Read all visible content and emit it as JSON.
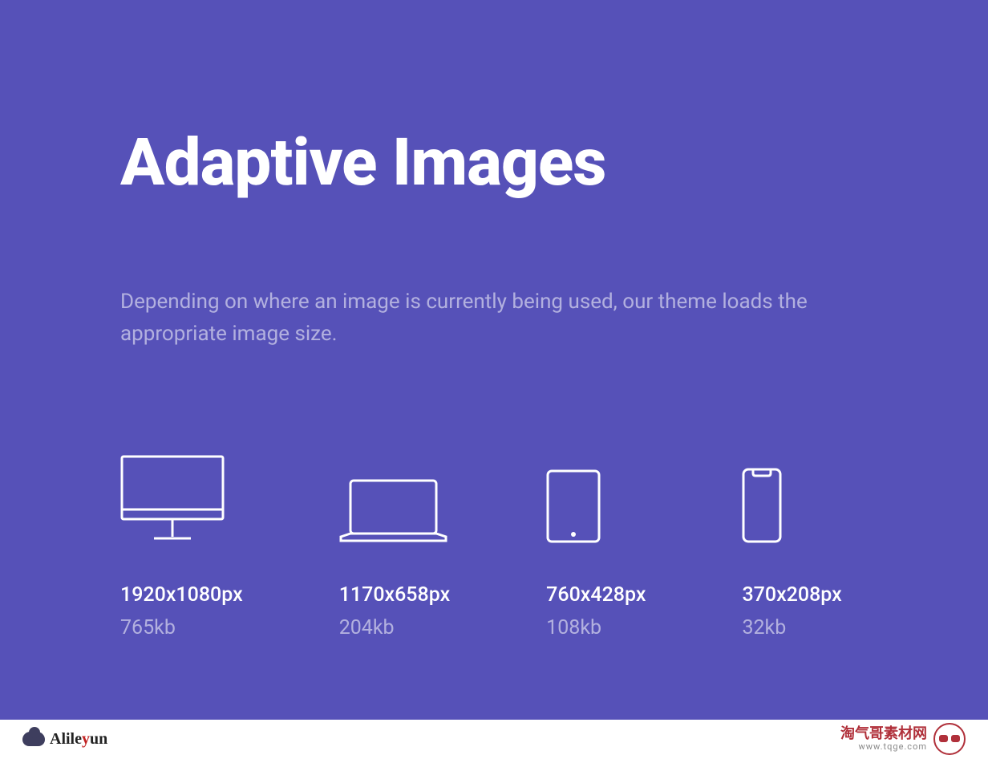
{
  "hero": {
    "title": "Adaptive Images",
    "subtitle": "Depending on where an image is currently being used, our theme loads the appropriate image size."
  },
  "devices": [
    {
      "icon": "desktop",
      "resolution": "1920x1080px",
      "filesize": "765kb"
    },
    {
      "icon": "laptop",
      "resolution": "1170x658px",
      "filesize": "204kb"
    },
    {
      "icon": "tablet",
      "resolution": "760x428px",
      "filesize": "108kb"
    },
    {
      "icon": "phone",
      "resolution": "370x208px",
      "filesize": "32kb"
    }
  ],
  "footer": {
    "left_brand": "Alileyun",
    "right_brand_cn": "淘气哥素材网",
    "right_brand_url": "www.tqge.com"
  }
}
